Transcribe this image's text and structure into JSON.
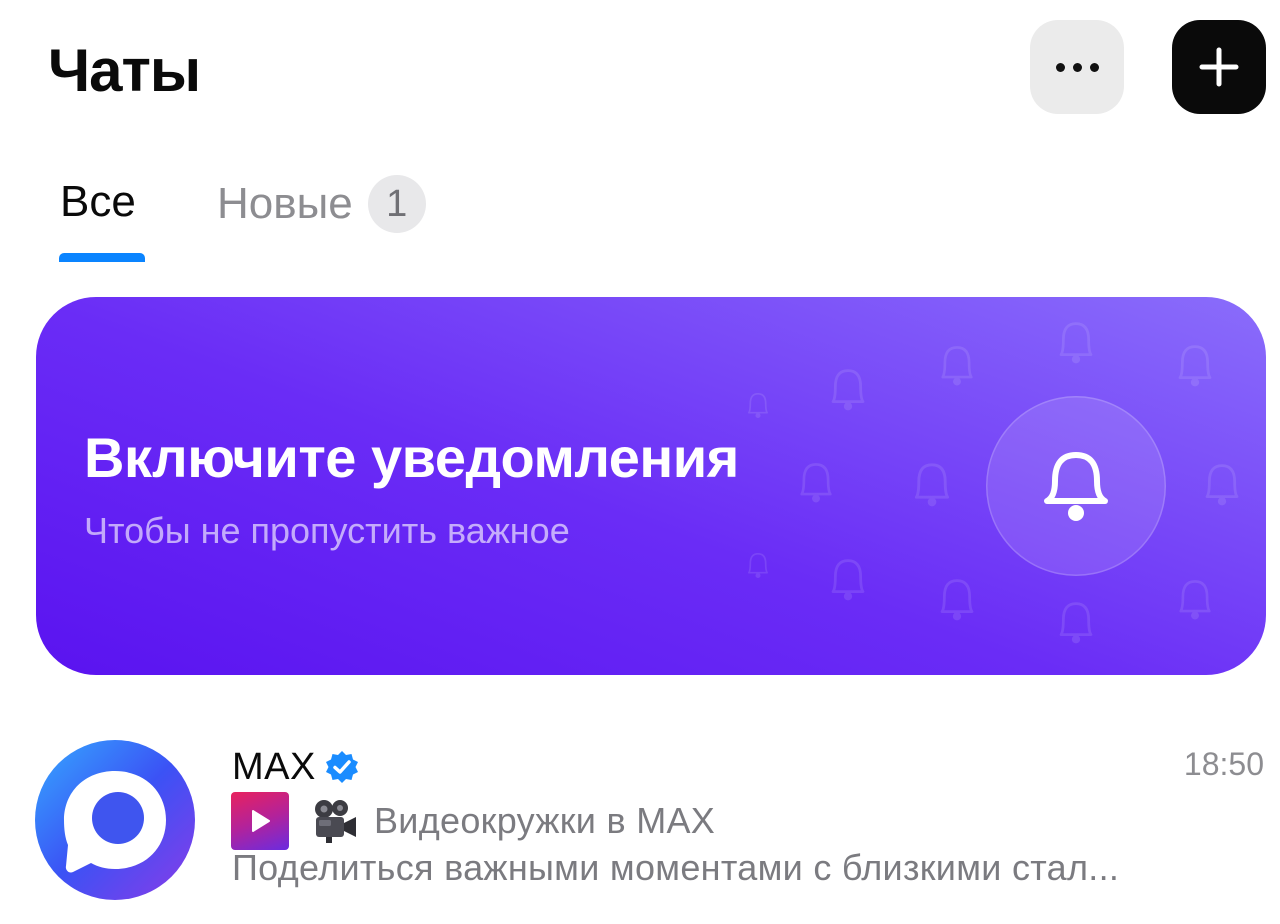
{
  "header": {
    "title": "Чаты",
    "more_icon": "ellipsis-icon",
    "new_icon": "plus-icon"
  },
  "tabs": [
    {
      "label": "Все",
      "active": true
    },
    {
      "label": "Новые",
      "badge": "1",
      "active": false
    }
  ],
  "banner": {
    "title": "Включите уведомления",
    "subtitle": "Чтобы не пропустить важное",
    "icon": "bell-icon",
    "gradient": [
      "#5a13f0",
      "#8a6dfb"
    ]
  },
  "chats": [
    {
      "name": "MAX",
      "verified": true,
      "time": "18:50",
      "preview_title": "Видеокружки в MAX",
      "preview_text": "Поделиться важными моментами с близкими стал...",
      "avatar_icon": "max-logo-icon"
    }
  ],
  "colors": {
    "accent": "#0a84ff",
    "dark_button": "#0a0a0a",
    "light_button": "#ebebeb",
    "muted_text": "#8d8d91"
  }
}
